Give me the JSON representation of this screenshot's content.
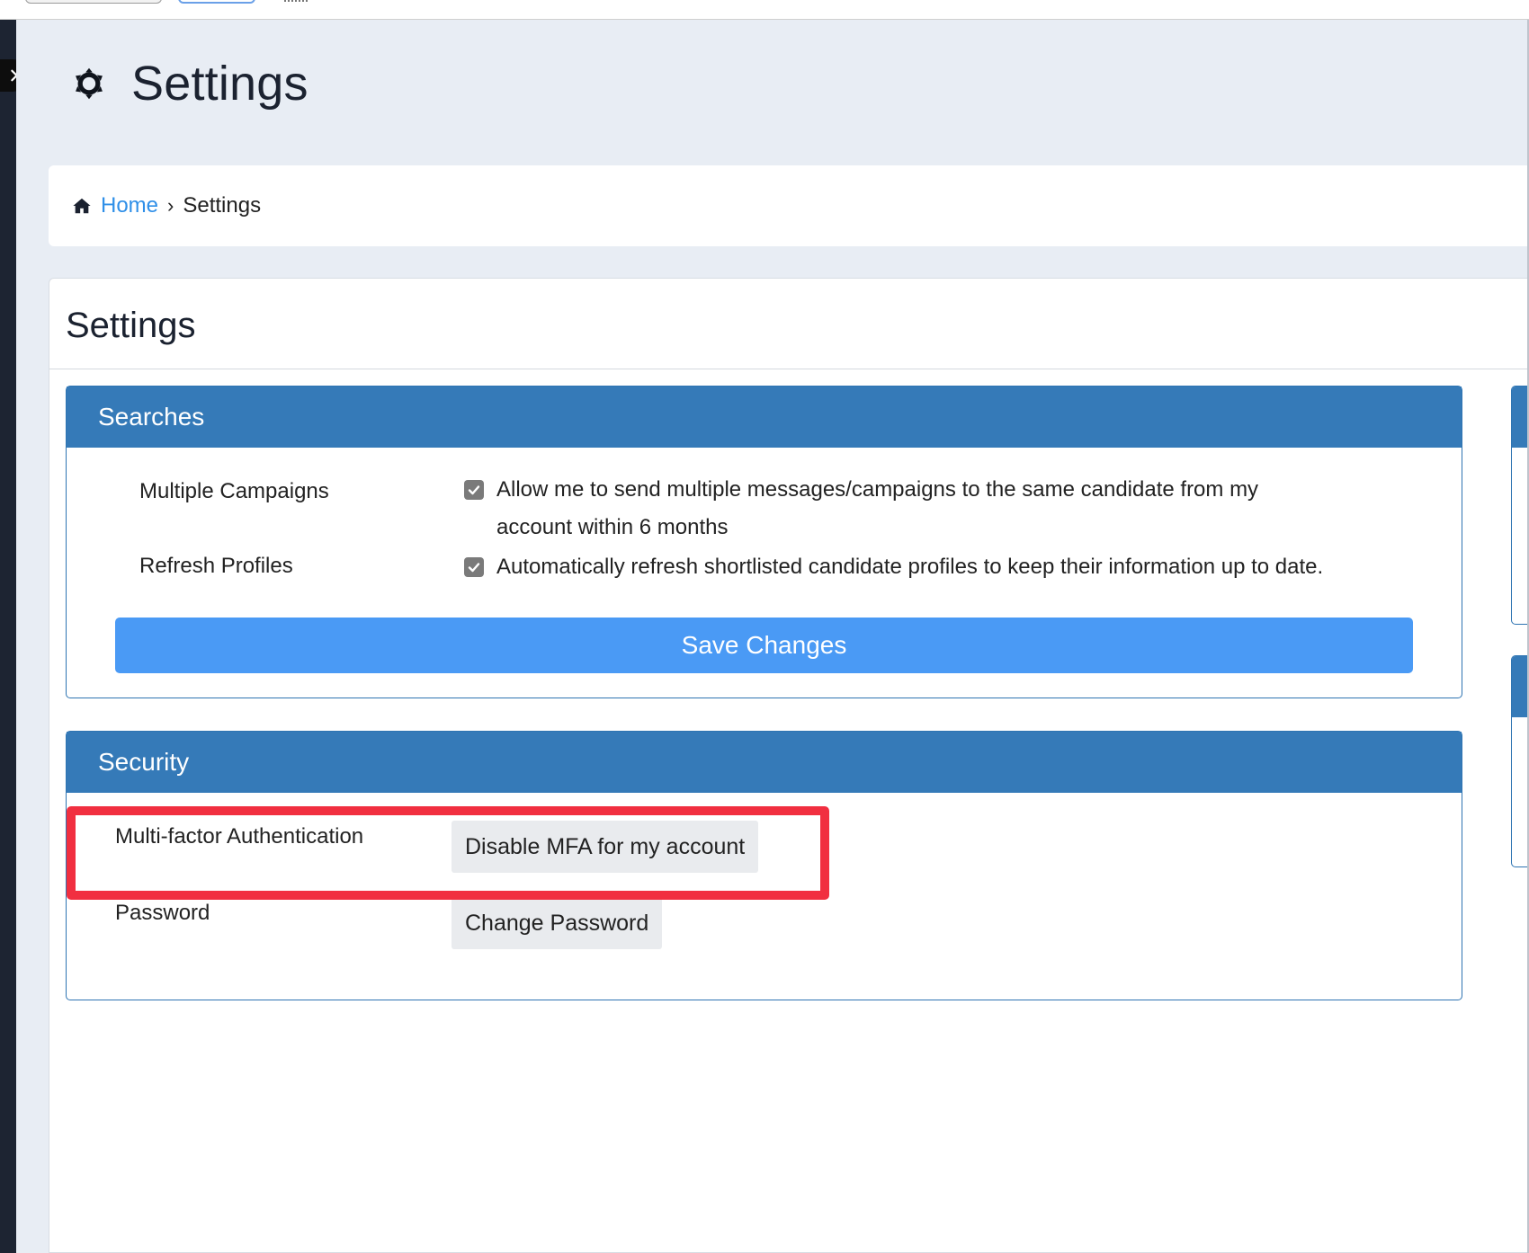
{
  "page": {
    "title": "Settings",
    "title_icon": "gear-icon"
  },
  "breadcrumb": {
    "home_icon": "home-icon",
    "home_label": "Home",
    "separator": "›",
    "current": "Settings"
  },
  "content": {
    "title": "Settings"
  },
  "searches_panel": {
    "heading": "Searches",
    "rows": [
      {
        "label": "Multiple Campaigns",
        "checked": true,
        "text_line1": "Allow me to send multiple messages/campaigns to the same candidate from my",
        "text_line2": "account within 6 months"
      },
      {
        "label": "Refresh Profiles",
        "checked": true,
        "text_line1": "Automatically refresh shortlisted candidate profiles to keep their information up to date."
      }
    ],
    "save_label": "Save Changes"
  },
  "security_panel": {
    "heading": "Security",
    "rows": [
      {
        "label": "Multi-factor Authentication",
        "button": "Disable MFA for my account"
      },
      {
        "label": "Password",
        "button": "Change Password"
      }
    ]
  },
  "colors": {
    "panel_header": "#357ab8",
    "primary_button": "#4a9af5",
    "link": "#2f8fe8",
    "highlight": "#f12f40",
    "background": "#e8edf4"
  }
}
